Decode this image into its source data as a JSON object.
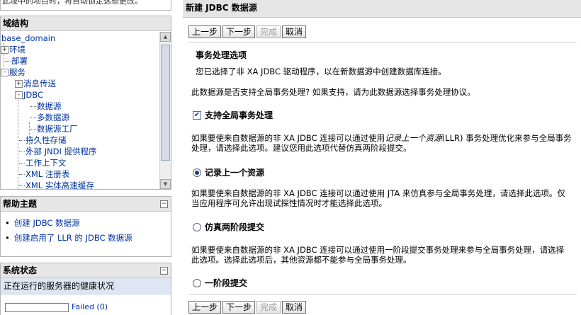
{
  "left": {
    "top_cut_text": "此域中的项目时，将自动锁定这些更改。",
    "domain_box": {
      "title": "域结构",
      "tree": [
        {
          "label": "base_domain"
        },
        {
          "label": "环境",
          "expander": "+"
        },
        {
          "label": "部署"
        },
        {
          "label": "服务",
          "expander": "-"
        },
        {
          "label": "消息传送",
          "expander": "+"
        },
        {
          "label": "JDBC",
          "expander": "-"
        },
        {
          "label": "数据源"
        },
        {
          "label": "多数据源"
        },
        {
          "label": "数据源工厂"
        },
        {
          "label": "持久性存储"
        },
        {
          "label": "外部 JNDI 提供程序"
        },
        {
          "label": "工作上下文"
        },
        {
          "label": "XML 注册表"
        },
        {
          "label": "XML 实体高速缓存"
        }
      ],
      "scroll_up": "▲",
      "scroll_down": "▼"
    },
    "help_box": {
      "title": "帮助主题",
      "collapse": "−",
      "links": [
        "创建 JDBC 数据源",
        "创建启用了 LLR 的 JDBC 数据源"
      ]
    },
    "status_box": {
      "title": "系统状态",
      "collapse": "−",
      "health_label": "正在运行的服务器的健康状况",
      "failed_link": "Failed (0)"
    }
  },
  "main": {
    "title": "新建 JDBC 数据源",
    "buttons": {
      "back": "上一步",
      "next": "下一步",
      "finish": "完成",
      "cancel": "取消"
    },
    "section_title": "事务处理选项",
    "intro": "您已选择了非 XA JDBC 驱动程序，以在新数据源中创建数据库连接。",
    "question": "此数据源是否支持全局事务处理? 如果支持，请为此数据源选择事务处理协议。",
    "global_tx_label": "支持全局事务处理",
    "global_tx_checked": true,
    "llr_desc_a": "如果要使来自数据源的非 XA JDBC 连接可以通过使用",
    "llr_desc_italic": "记录上一个资源",
    "llr_desc_b": "(LLR) 事务处理优化来参与全局事务",
    "llr_desc_line2": "处理，请选择此选项。建议您用此选项代替仿真两阶段提交。",
    "llr_label": "记录上一个资源",
    "emulate_desc_line1": "如果要使来自数据源的非 XA JDBC 连接可以通过使用 JTA 来仿真参与全局事务处理，请选择此选项。仅",
    "emulate_desc_line2": "当应用程序可允许出现试探性情况时才能选择此选项。",
    "emulate_label": "仿真两阶段提交",
    "onephase_desc_line1": "如果要使来自数据源的非 XA JDBC 连接可以通过使用一阶段提交事务处理来参与全局事务处理，请选择",
    "onephase_desc_line2": "此选项。选择此选项后，其他资源都不能参与全局事务处理。",
    "onephase_label": "一阶段提交",
    "selected_protocol": "记录上一个资源"
  }
}
